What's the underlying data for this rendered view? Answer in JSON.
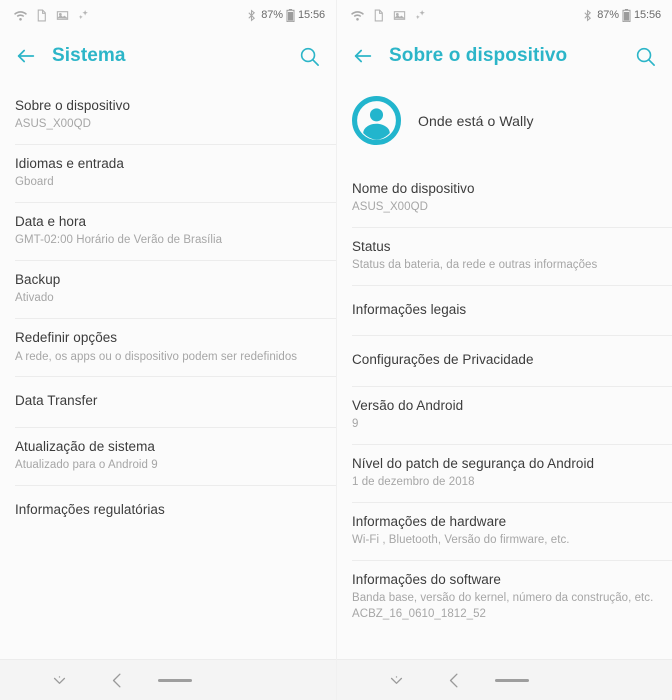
{
  "accent_color": "#2cb5c8",
  "statusbar": {
    "left_icons": [
      "wifi-icon",
      "document-icon",
      "image-icon",
      "sparkle-icon"
    ],
    "bluetooth_icon": "bluetooth-icon",
    "battery_percent": "87%",
    "battery_icon": "battery-icon",
    "clock": "15:56"
  },
  "left_panel": {
    "appbar": {
      "back_icon": "back-arrow-icon",
      "title": "Sistema",
      "search_icon": "search-icon"
    },
    "items": [
      {
        "title": "Sobre o dispositivo",
        "sub": "ASUS_X00QD"
      },
      {
        "title": "Idiomas e entrada",
        "sub": "Gboard"
      },
      {
        "title": "Data e hora",
        "sub": "GMT-02:00 Horário de Verão de Brasília"
      },
      {
        "title": "Backup",
        "sub": "Ativado"
      },
      {
        "title": "Redefinir opções",
        "sub": "A rede, os apps ou o dispositivo podem ser redefinidos"
      },
      {
        "title": "Data Transfer",
        "sub": ""
      },
      {
        "title": "Atualização de sistema",
        "sub": "Atualizado para o Android 9"
      },
      {
        "title": "Informações regulatórias",
        "sub": ""
      }
    ]
  },
  "right_panel": {
    "appbar": {
      "back_icon": "back-arrow-icon",
      "title": "Sobre o dispositivo",
      "search_icon": "search-icon"
    },
    "account": {
      "avatar_icon": "account-avatar-icon",
      "name": "Onde está o Wally"
    },
    "items": [
      {
        "title": "Nome do dispositivo",
        "sub": "ASUS_X00QD"
      },
      {
        "title": "Status",
        "sub": "Status da bateria, da rede e outras informações"
      },
      {
        "title": "Informações legais",
        "sub": ""
      },
      {
        "title": "Configurações de Privacidade",
        "sub": ""
      },
      {
        "title": "Versão do Android",
        "sub": "9"
      },
      {
        "title": "Nível do patch de segurança do Android",
        "sub": "1 de dezembro de 2018"
      },
      {
        "title": "Informações de hardware",
        "sub": "Wi-Fi , Bluetooth, Versão do firmware, etc."
      },
      {
        "title": "Informações do software",
        "sub": "Banda base, versão do kernel, número da construção, etc.\nACBZ_16_0610_1812_52"
      }
    ]
  },
  "navbar": {
    "hide_icon": "chevron-down-icon",
    "back_icon": "back-chevron-icon",
    "home_icon": "home-bar-icon"
  }
}
